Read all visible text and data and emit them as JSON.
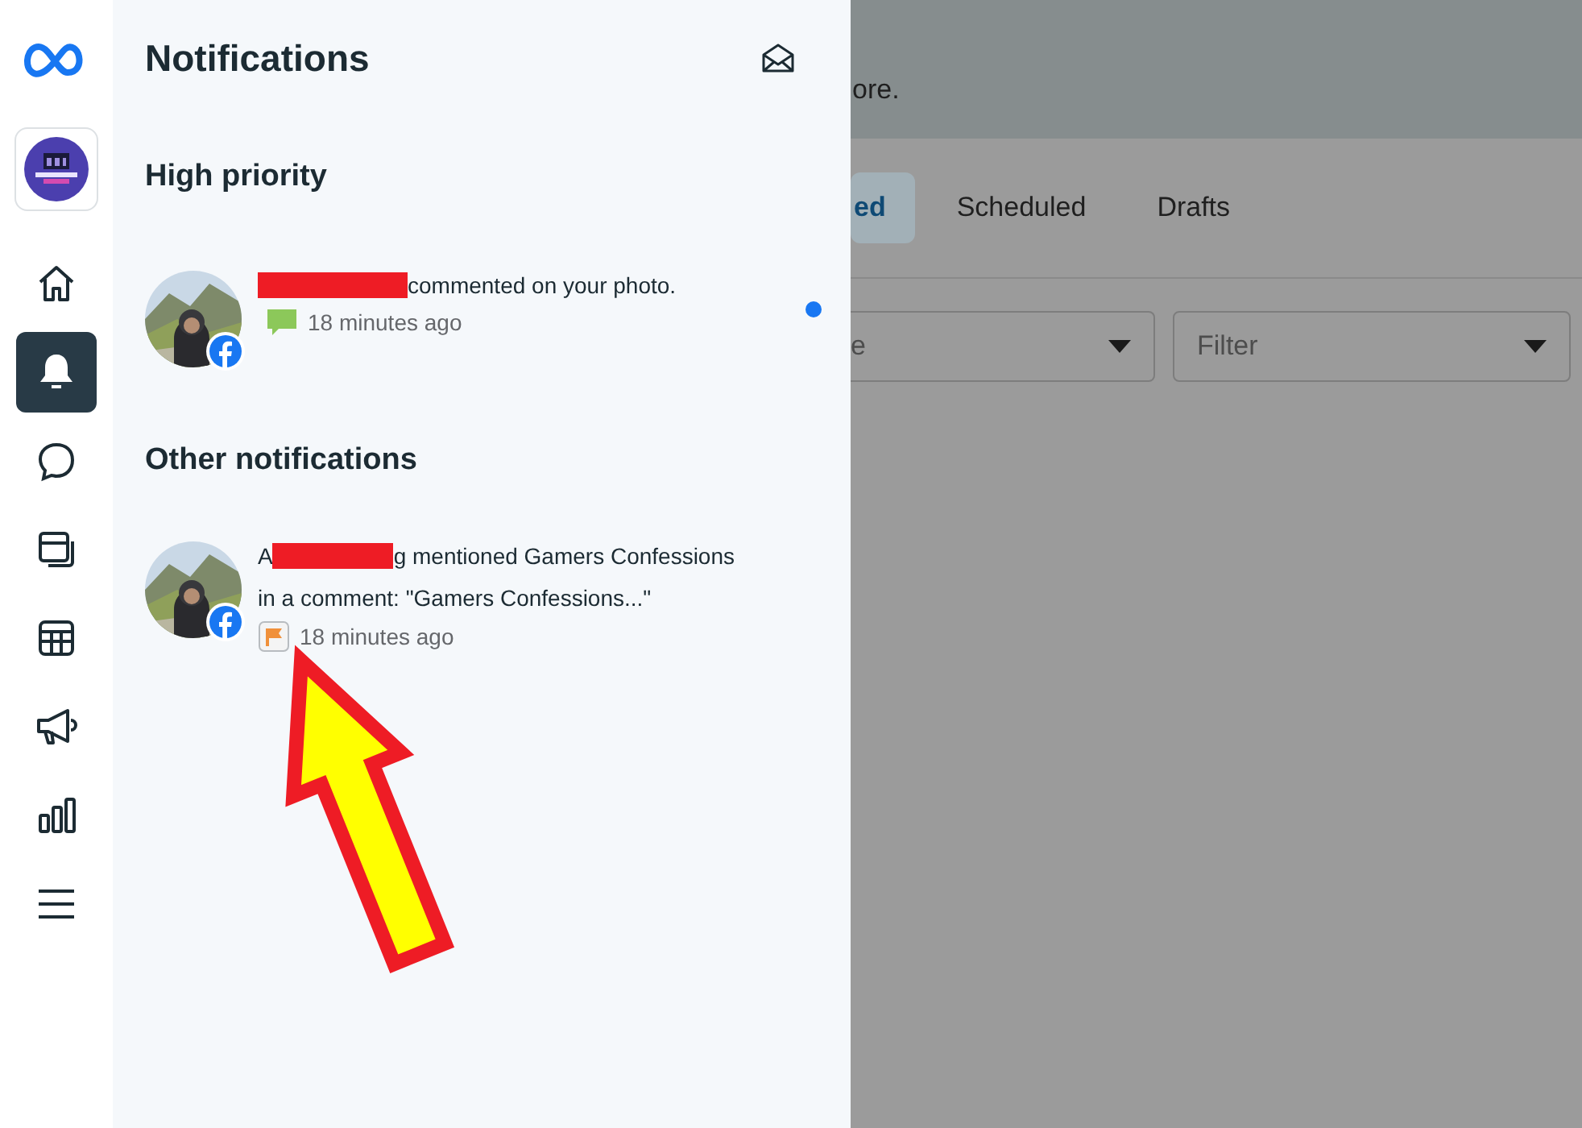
{
  "rail": {
    "items": [
      {
        "kind": "meta",
        "selected": false
      },
      {
        "kind": "page",
        "selected": false
      },
      {
        "kind": "home",
        "selected": false
      },
      {
        "kind": "bell",
        "selected": true
      },
      {
        "kind": "chat",
        "selected": false
      },
      {
        "kind": "content",
        "selected": false
      },
      {
        "kind": "table",
        "selected": false
      },
      {
        "kind": "megaphone",
        "selected": false
      },
      {
        "kind": "chart",
        "selected": false
      },
      {
        "kind": "menu",
        "selected": false
      }
    ]
  },
  "panel": {
    "title": "Notifications",
    "sections": [
      {
        "heading": "High priority",
        "items": [
          {
            "after": "commented on your photo.",
            "time": "18 minutes ago",
            "kind": "comment",
            "unread": true
          }
        ]
      },
      {
        "heading": "Other notifications",
        "items": [
          {
            "before": "A",
            "after": "g mentioned Gamers Confessions",
            "line2": "in a comment: \"Gamers Confessions...\"",
            "time": "18 minutes ago",
            "kind": "flag",
            "unread": false
          }
        ]
      }
    ]
  },
  "background": {
    "banner_text": "ore.",
    "tabs": [
      {
        "label": "ed",
        "selected": true
      },
      {
        "label": "Scheduled",
        "selected": false
      },
      {
        "label": "Drafts",
        "selected": false
      }
    ],
    "dropdowns": [
      {
        "value": "e"
      },
      {
        "value": "Filter"
      }
    ]
  }
}
